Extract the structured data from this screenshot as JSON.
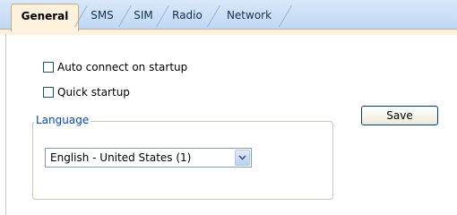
{
  "tabs": [
    {
      "label": "General",
      "active": true
    },
    {
      "label": "SMS",
      "active": false
    },
    {
      "label": "SIM",
      "active": false
    },
    {
      "label": "Radio",
      "active": false
    },
    {
      "label": "Network",
      "active": false
    }
  ],
  "options": {
    "auto_connect": {
      "label": "Auto connect on startup",
      "checked": false
    },
    "quick_startup": {
      "label": "Quick startup",
      "checked": false
    }
  },
  "language": {
    "legend": "Language",
    "selected": "English - United States (1)"
  },
  "actions": {
    "save_label": "Save"
  }
}
